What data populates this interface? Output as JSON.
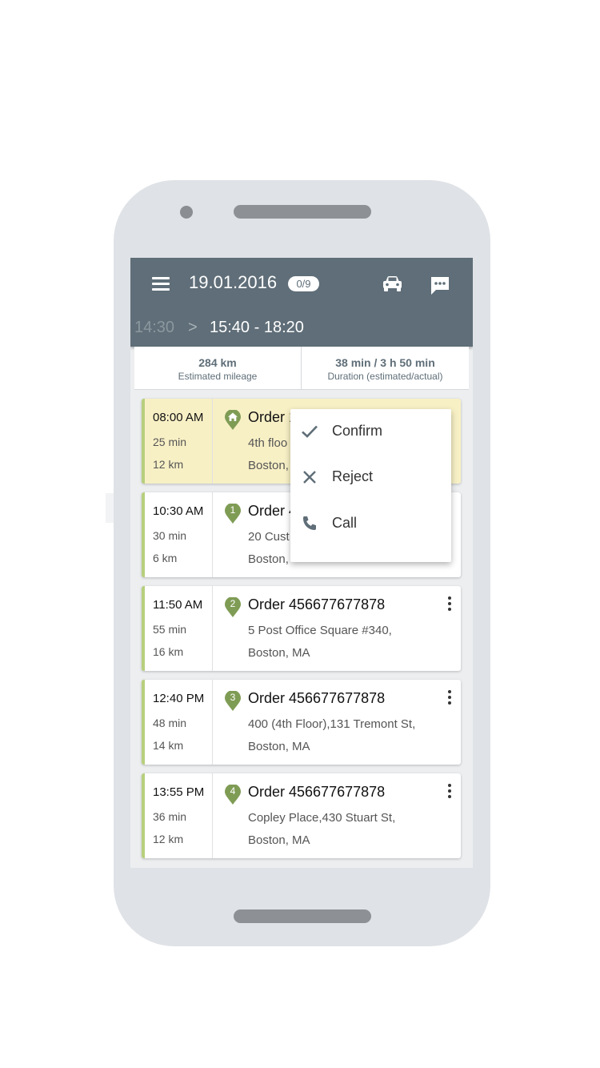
{
  "header": {
    "date": "19.01.2016",
    "progress_badge": "0/9",
    "previous_window": "14:30",
    "chevron": ">",
    "current_window": "15:40 - 18:20"
  },
  "stats": {
    "mileage_value": "284 km",
    "mileage_label": "Estimated mileage",
    "duration_value": "38 min / 3 h 50 min",
    "duration_label": "Duration (estimated/actual)"
  },
  "stops": [
    {
      "marker": "home",
      "time": "08:00 AM",
      "duration": "25 min",
      "distance": "12 km",
      "order": "Order 1",
      "address_line1": "4th floo",
      "address_line2": "Boston,",
      "highlighted": true
    },
    {
      "marker": "1",
      "time": "10:30 AM",
      "duration": "30 min",
      "distance": "6 km",
      "order": "Order 4",
      "address_line1": "20 Cust",
      "address_line2": "Boston,",
      "highlighted": false
    },
    {
      "marker": "2",
      "time": "11:50 AM",
      "duration": "55 min",
      "distance": "16 km",
      "order": "Order 456677677878",
      "address_line1": "5 Post Office Square #340,",
      "address_line2": "Boston, MA",
      "highlighted": false
    },
    {
      "marker": "3",
      "time": "12:40 PM",
      "duration": "48 min",
      "distance": "14 km",
      "order": "Order 456677677878",
      "address_line1": "400 (4th Floor),131 Tremont St,",
      "address_line2": "Boston, MA",
      "highlighted": false
    },
    {
      "marker": "4",
      "time": "13:55 PM",
      "duration": "36 min",
      "distance": "12 km",
      "order": "Order 456677677878",
      "address_line1": "Copley Place,430 Stuart St,",
      "address_line2": "Boston, MA",
      "highlighted": false
    }
  ],
  "context_menu": {
    "items": [
      {
        "icon": "check-icon",
        "label": "Confirm"
      },
      {
        "icon": "close-icon",
        "label": "Reject"
      },
      {
        "icon": "phone-icon",
        "label": "Call"
      }
    ]
  },
  "colors": {
    "appbar": "#5f6e78",
    "accent_green": "#7f9c55",
    "stripe": "#b7cf7d",
    "highlight": "#f8f0c5"
  }
}
